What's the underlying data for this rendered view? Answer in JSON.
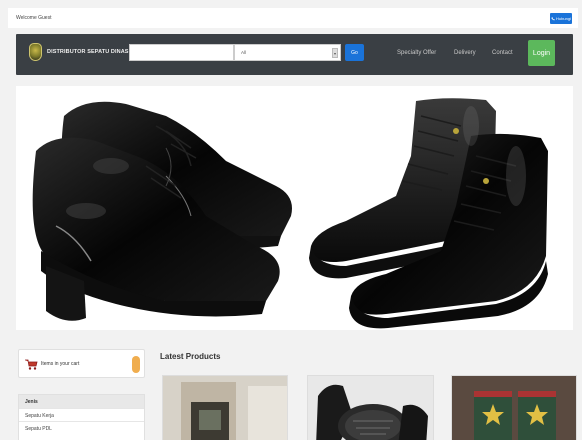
{
  "topbar": {
    "welcome": "Welcome Guest",
    "action_label": "Hubungi"
  },
  "navbar": {
    "brand": "DISTRIBUTOR SEPATU DINAS",
    "search": {
      "value": "",
      "placeholder": ""
    },
    "category_select": {
      "selected": "All"
    },
    "go_label": "Go",
    "links": [
      "Specialty Offer",
      "Delivery",
      "Contact"
    ],
    "login_label": "Login"
  },
  "hero": {
    "image": "black-formal-shoes-and-boots-banner"
  },
  "cart": {
    "label": "Items in your cart"
  },
  "categories": {
    "title": "Jenis",
    "items": [
      "Sepatu Kerja",
      "Sepatu PDL"
    ]
  },
  "latest": {
    "title": "Latest Products"
  },
  "colors": {
    "navbar": "#3a3f44",
    "accent": "#1a73d9",
    "login": "#5cb85c",
    "badge": "#f0ad4e"
  }
}
